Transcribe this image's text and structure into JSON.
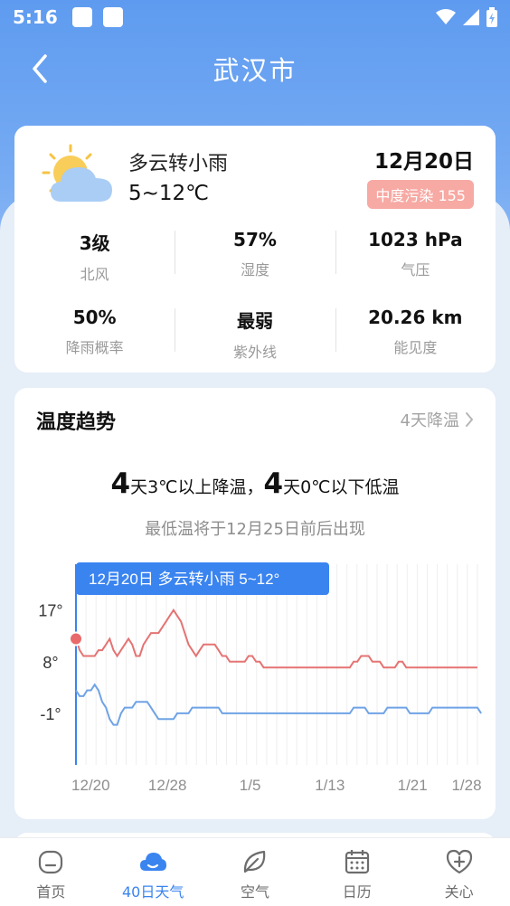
{
  "status_bar": {
    "time": "5:16"
  },
  "header": {
    "title": "武汉市"
  },
  "current": {
    "condition": "多云转小雨",
    "temp_range": "5~12℃",
    "date": "12月20日",
    "aqi_label": "中度污染 155",
    "icon": "partly-cloudy-icon",
    "stats": [
      [
        {
          "value": "3级",
          "label": "北风"
        },
        {
          "value": "57%",
          "label": "湿度"
        },
        {
          "value": "1023 hPa",
          "label": "气压"
        }
      ],
      [
        {
          "value": "50%",
          "label": "降雨概率"
        },
        {
          "value": "最弱",
          "label": "紫外线"
        },
        {
          "value": "20.26 km",
          "label": "能见度"
        }
      ]
    ]
  },
  "trend": {
    "title": "温度趋势",
    "link": "4天降温",
    "summary_num1": "4",
    "summary_text1": "天3℃以上降温，",
    "summary_num2": "4",
    "summary_text2": "天0℃以下低温",
    "subtitle": "最低温将于12月25日前后出现",
    "tooltip": "12月20日 多云转小雨 5~12°"
  },
  "chart_data": {
    "type": "line",
    "y_ticks": [
      "17°",
      "8°",
      "-1°"
    ],
    "x_ticks": [
      "12/20",
      "12/28",
      "1/5",
      "1/13",
      "1/21",
      "1/28"
    ],
    "ylim": [
      -10,
      25
    ],
    "series": [
      {
        "values": [
          12,
          10,
          9,
          9,
          9,
          9,
          10,
          10,
          11,
          12,
          10,
          9,
          10,
          11,
          12,
          11,
          9,
          9,
          11,
          12,
          13,
          13,
          13,
          14,
          15,
          16,
          17,
          16,
          15,
          13,
          11,
          10,
          9,
          10,
          11,
          11,
          11,
          11,
          10,
          9,
          9,
          8,
          8,
          8,
          8,
          8,
          9,
          9,
          8,
          8,
          7,
          7,
          7,
          7,
          7,
          7,
          7,
          7,
          7,
          7,
          7,
          7,
          7,
          7,
          7,
          7,
          7,
          7,
          7,
          7,
          7,
          7,
          7,
          7,
          8,
          8,
          9,
          9,
          9,
          8,
          8,
          8,
          7,
          7,
          7,
          7,
          8,
          8,
          7,
          7,
          7,
          7,
          7,
          7,
          7,
          7,
          7,
          7,
          7,
          7,
          7,
          7,
          7,
          7,
          7,
          7,
          7,
          7
        ]
      },
      {
        "values": [
          3,
          2,
          2,
          3,
          3,
          4,
          3,
          1,
          0,
          -2,
          -3,
          -3,
          -1,
          0,
          0,
          0,
          1,
          1,
          1,
          1,
          0,
          -1,
          -2,
          -2,
          -2,
          -2,
          -2,
          -1,
          -1,
          -1,
          -1,
          0,
          0,
          0,
          0,
          0,
          0,
          0,
          0,
          -1,
          -1,
          -1,
          -1,
          -1,
          -1,
          -1,
          -1,
          -1,
          -1,
          -1,
          -1,
          -1,
          -1,
          -1,
          -1,
          -1,
          -1,
          -1,
          -1,
          -1,
          -1,
          -1,
          -1,
          -1,
          -1,
          -1,
          -1,
          -1,
          -1,
          -1,
          -1,
          -1,
          -1,
          -1,
          0,
          0,
          0,
          0,
          -1,
          -1,
          -1,
          -1,
          -1,
          0,
          0,
          0,
          0,
          0,
          0,
          -1,
          -1,
          -1,
          -1,
          -1,
          -1,
          0,
          0,
          0,
          0,
          0,
          0,
          0,
          0,
          0,
          0,
          0,
          0,
          0,
          -1
        ]
      }
    ],
    "colors": {
      "high": "#e57373",
      "low": "#6fa3e6",
      "accent": "#3a84f0"
    },
    "grid": true
  },
  "tabs": [
    {
      "label": "首页",
      "icon": "home-icon"
    },
    {
      "label": "40日天气",
      "icon": "cloud-icon",
      "active": true
    },
    {
      "label": "空气",
      "icon": "leaf-icon"
    },
    {
      "label": "日历",
      "icon": "calendar-icon"
    },
    {
      "label": "关心",
      "icon": "heart-plus-icon"
    }
  ]
}
